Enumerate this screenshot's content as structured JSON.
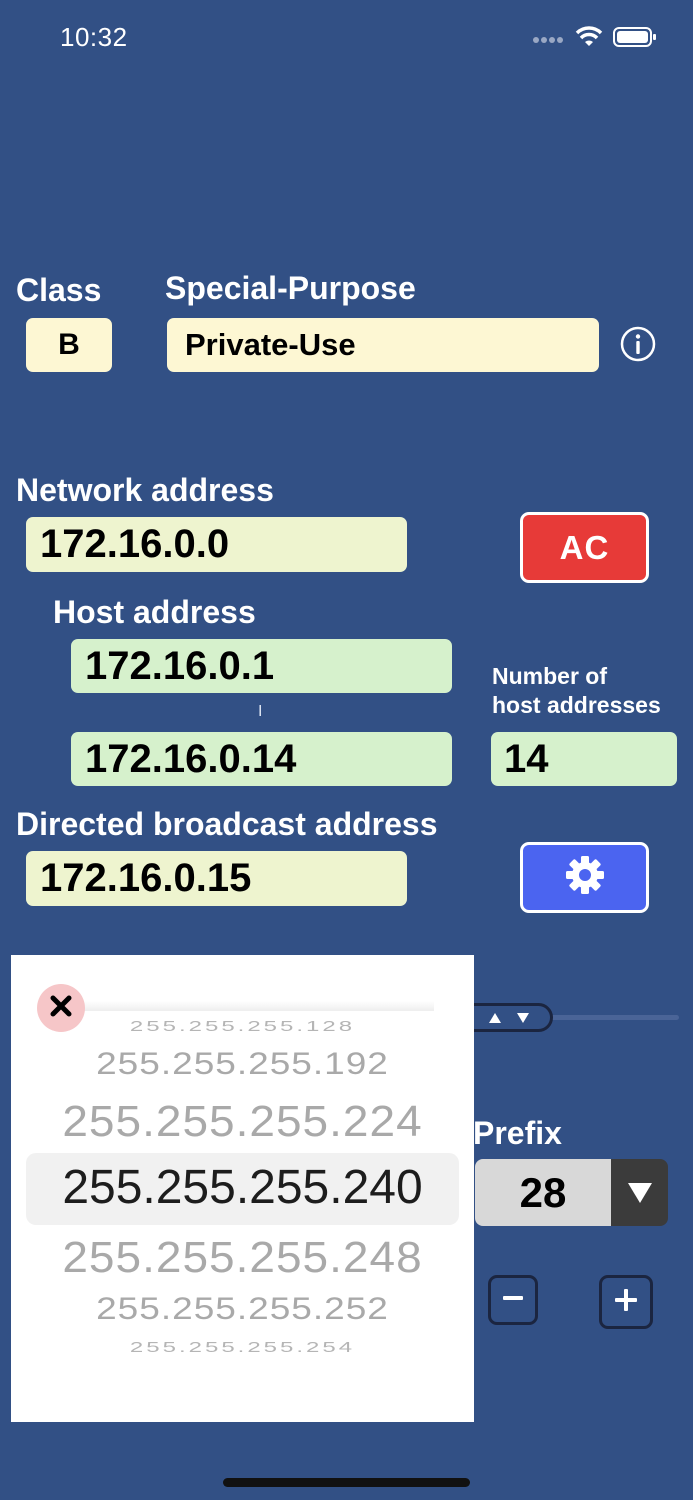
{
  "status_bar": {
    "time": "10:32"
  },
  "class_section": {
    "label": "Class",
    "value": "B"
  },
  "special_purpose": {
    "label": "Special-Purpose",
    "value": "Private-Use"
  },
  "network": {
    "label": "Network address",
    "value": "172.16.0.0"
  },
  "clear_button": {
    "label": "AC"
  },
  "host": {
    "label": "Host address",
    "first": "172.16.0.1",
    "separator": "I",
    "last": "172.16.0.14"
  },
  "host_count": {
    "label_line1": "Number of",
    "label_line2": "host addresses",
    "value": "14"
  },
  "broadcast": {
    "label": "Directed broadcast address",
    "value": "172.16.0.15"
  },
  "mask_picker": {
    "items": [
      "255.255.255.128",
      "255.255.255.192",
      "255.255.255.224",
      "255.255.255.240",
      "255.255.255.248",
      "255.255.255.252",
      "255.255.255.254"
    ],
    "selected": "255.255.255.240"
  },
  "prefix": {
    "label": "Prefix",
    "value": "28"
  },
  "colors": {
    "background": "#325085",
    "ac_button": "#e73a38",
    "settings_button": "#4b64f0",
    "field_yellow": "#fdf7d3",
    "field_green": "#d6f1cc"
  },
  "icons": [
    "wifi-icon",
    "battery-icon",
    "info-icon",
    "gear-icon",
    "close-icon",
    "stepper-arrows-icon",
    "dropdown-arrow-icon",
    "minus-icon",
    "plus-icon"
  ]
}
